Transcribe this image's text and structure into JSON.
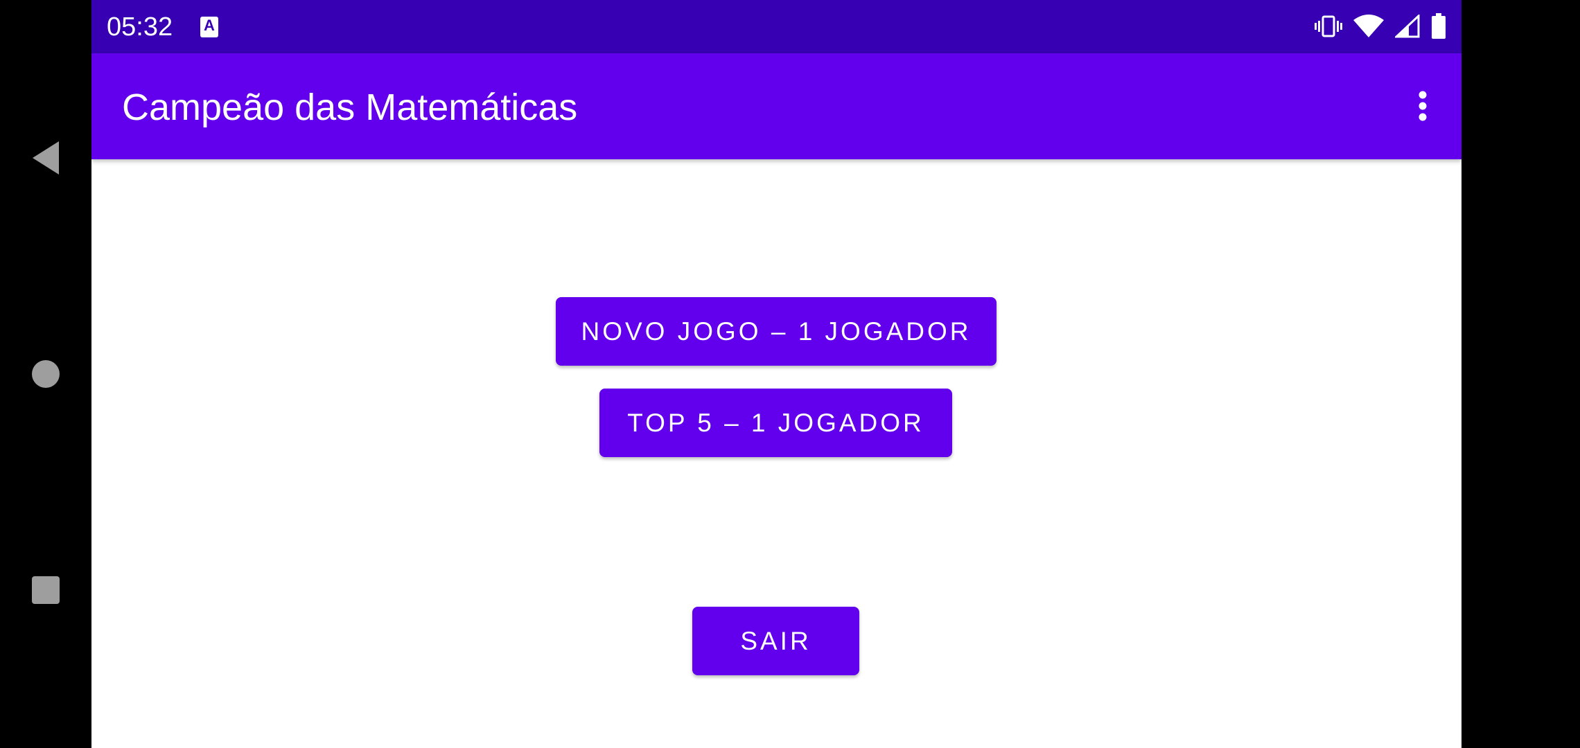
{
  "status_bar": {
    "time": "05:32",
    "app_icon_letter": "A",
    "icons": [
      "vibrate-icon",
      "wifi-icon",
      "signal-icon",
      "battery-icon"
    ]
  },
  "app_bar": {
    "title": "Campeão das Matemáticas",
    "overflow_icon": "more-vert-icon"
  },
  "main": {
    "new_game_label": "NOVO JOGO – 1 JOGADOR",
    "top5_label": "TOP 5 – 1 JOGADOR",
    "exit_label": "SAIR"
  },
  "nav": {
    "back_icon": "back-icon",
    "home_icon": "home-icon",
    "recents_icon": "recents-icon"
  },
  "colors": {
    "status_bar": "#3700b3",
    "primary": "#6200ee",
    "background": "#ffffff",
    "nav_icons": "#9e9e9e"
  }
}
